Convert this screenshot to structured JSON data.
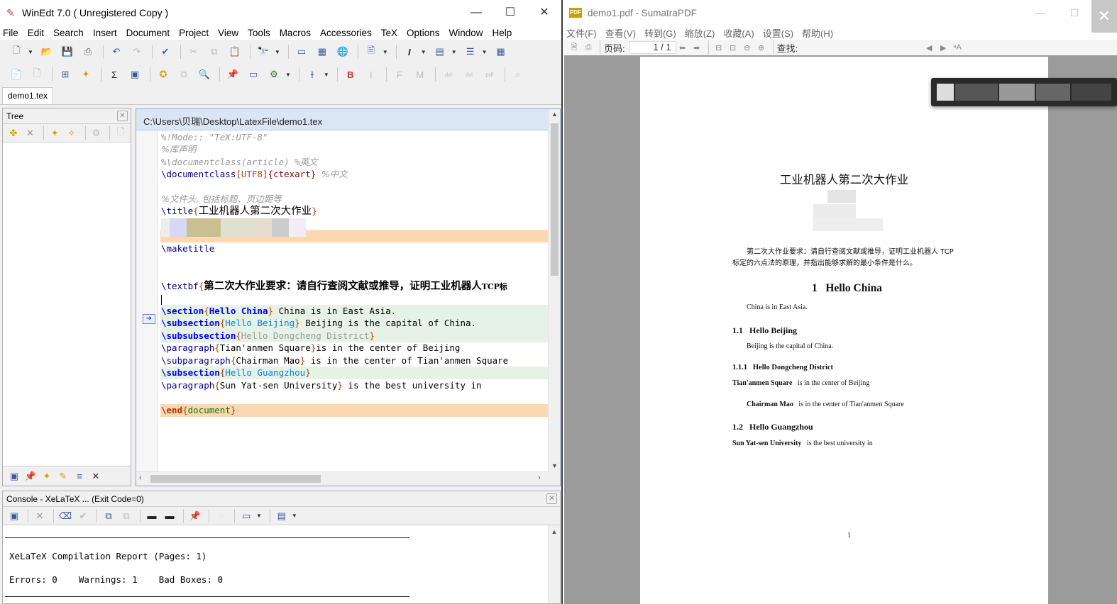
{
  "winedt": {
    "title": "WinEdt 7.0  ( Unregistered  Copy )",
    "menu": [
      "File",
      "Edit",
      "Search",
      "Insert",
      "Document",
      "Project",
      "View",
      "Tools",
      "Macros",
      "Accessories",
      "TeX",
      "Options",
      "Window",
      "Help"
    ],
    "tab": "demo1.tex",
    "tree_label": "Tree",
    "editor_path": "C:\\Users\\贝瑞\\Desktop\\LatexFile\\demo1.tex",
    "code": {
      "l1": "%!Mode:: \"TeX:UTF-8\"",
      "l2": "%库声明",
      "l3": "%\\documentclass(article) %英文",
      "l4_cmd": "\\documentclass",
      "l4_opt": "[UTF8]",
      "l4_arg": "{ctexart}",
      "l4_comment": "%中文",
      "l6": "%文件头, 包括标题、页边距等",
      "l7_cmd": "\\title",
      "l7_arg": "工业机器人第二次大作业",
      "l9": "\\maketitle",
      "l11_cmd": "\\textbf",
      "l11_arg": "第二次大作业要求：请自行查阅文献或推导，证明工业机器人",
      "l11_tail": "TCP标",
      "l13_cmd": "\\section",
      "l13_arg": "Hello China",
      "l13_text": " China is in East Asia.",
      "l14_cmd": "\\subsection",
      "l14_arg": "Hello Beijing",
      "l14_text": " Beijing is the capital of China.",
      "l15_cmd": "\\subsubsection",
      "l15_arg": "Hello Dongcheng District",
      "l16_cmd": "\\paragraph",
      "l16_arg": "Tian'anmen Square",
      "l16_text": "is in the center of Beijing",
      "l17_cmd": "\\subparagraph",
      "l17_arg": "Chairman Mao",
      "l17_text": " is in the center of Tian'anmen Square",
      "l18_cmd": "\\subsection",
      "l18_arg": "Hello Guangzhou",
      "l19_cmd": "\\paragraph",
      "l19_arg": "Sun Yat-sen University",
      "l19_text": " is the best university in",
      "l21_cmd": "\\end",
      "l21_arg": "document"
    },
    "console": {
      "title": "Console - XeLaTeX ... (Exit Code=0)",
      "report": "XeLaTeX Compilation Report (Pages: 1)",
      "stats": "Errors: 0    Warnings: 1    Bad Boxes: 0"
    }
  },
  "sumatra": {
    "title": "demo1.pdf - SumatraPDF",
    "menu": [
      "文件(F)",
      "查看(V)",
      "转到(G)",
      "缩放(Z)",
      "收藏(A)",
      "设置(S)",
      "帮助(H)"
    ],
    "page_label": "页码:",
    "page_value": "1 / 1",
    "find_label": "查找:",
    "pdf": {
      "title": "工业机器人第二次大作业",
      "abstract_l1": "第二次大作业要求：请自行查阅文献或推导，证明工业机器人 TCP",
      "abstract_l2": "标定的六点法的原理，并指出能够求解的最小条件是什么。",
      "sec1_num": "1",
      "sec1_title": "Hello China",
      "sec1_text": "China is in East Asia.",
      "sub11_num": "1.1",
      "sub11_title": "Hello Beijing",
      "sub11_text": "Beijing is the capital of China.",
      "subsub_num": "1.1.1",
      "subsub_title": "Hello Dongcheng District",
      "para1_title": "Tian'anmen Square",
      "para1_text": "is in the center of Beijing",
      "subpara_title": "Chairman Mao",
      "subpara_text": "is in the center of Tian'anmen Square",
      "sub12_num": "1.2",
      "sub12_title": "Hello Guangzhou",
      "para2_title": "Sun Yat-sen University",
      "para2_text": "is the best university in",
      "page_number": "1"
    }
  }
}
